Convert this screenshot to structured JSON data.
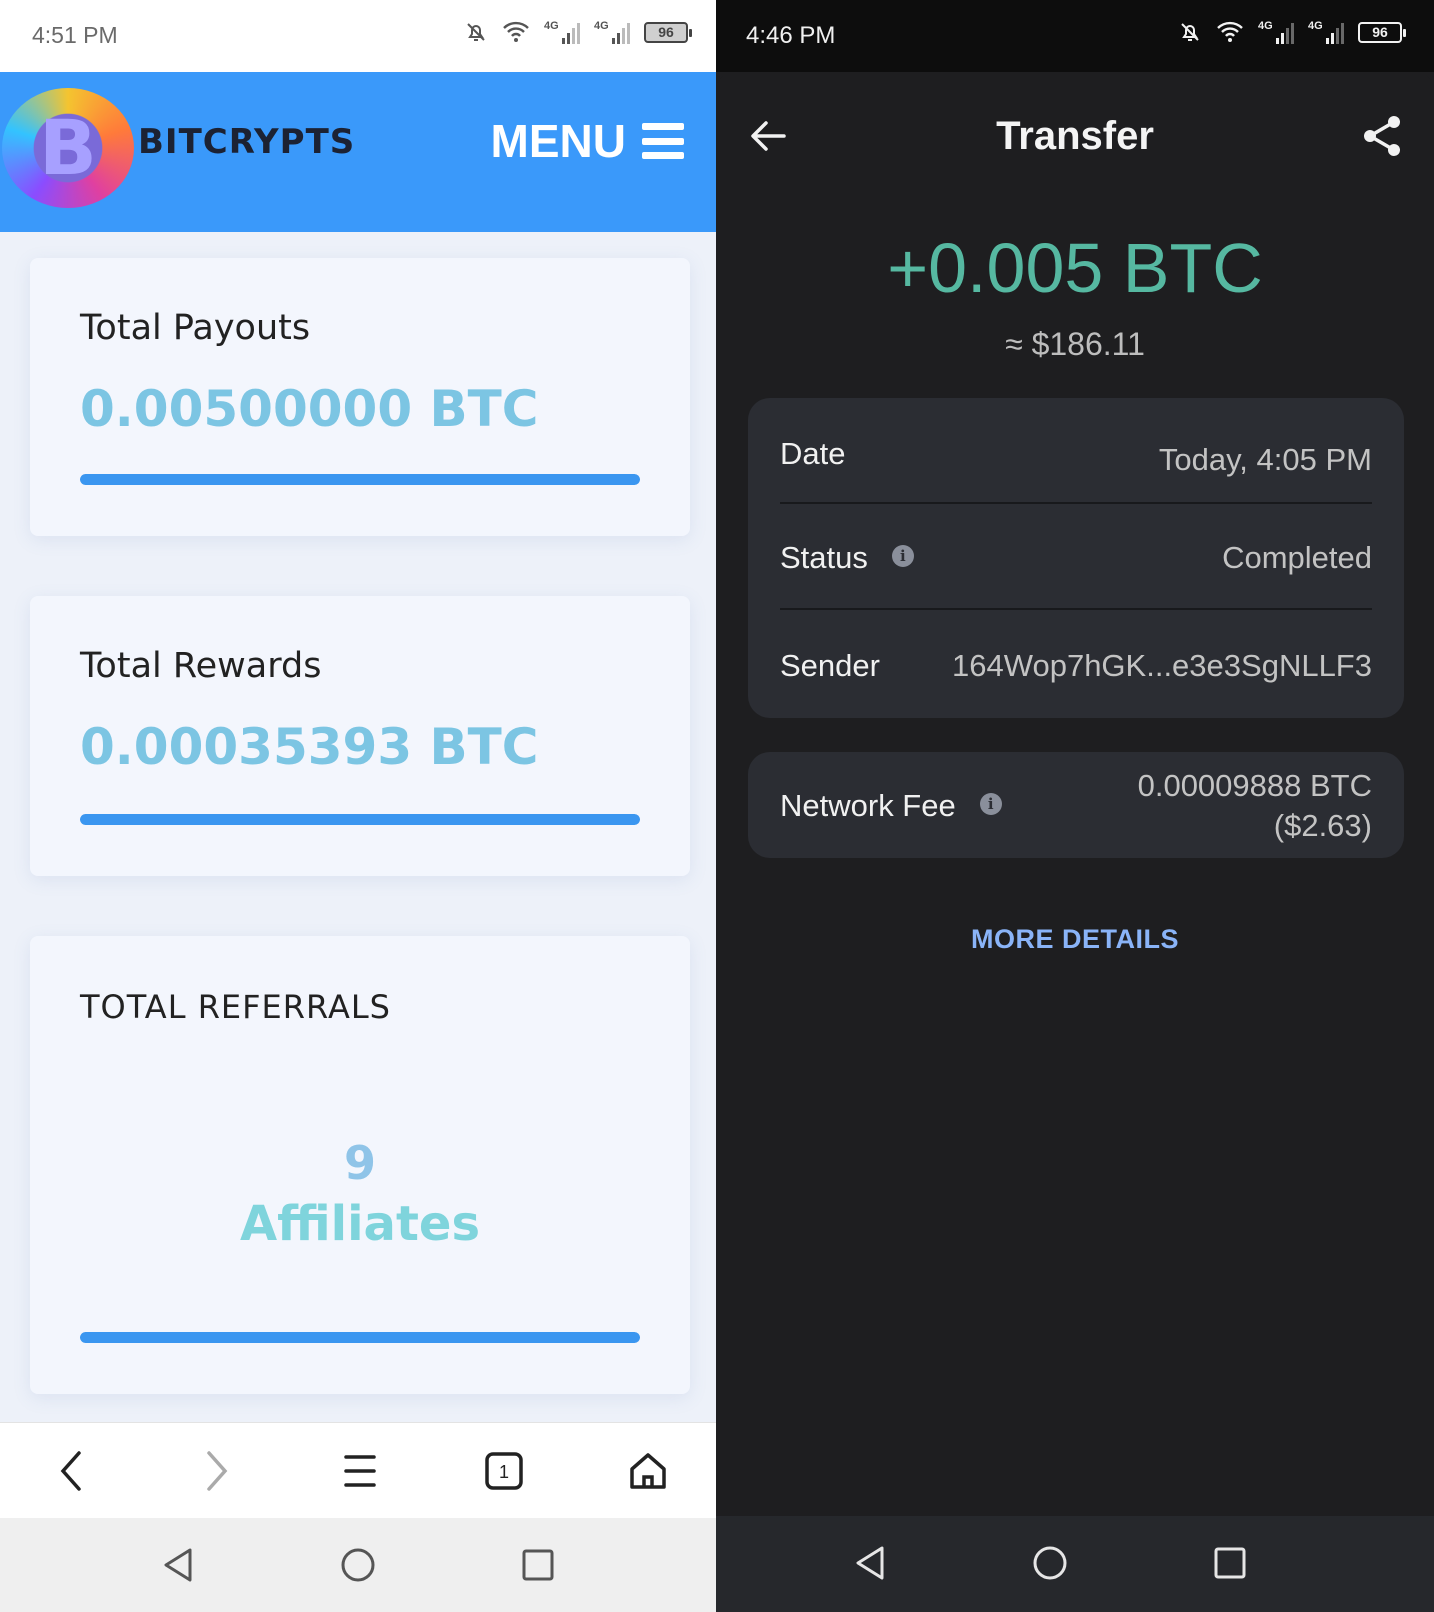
{
  "left": {
    "status_bar": {
      "time": "4:51 PM",
      "net1": "4G",
      "net2": "4G",
      "battery": "96"
    },
    "header": {
      "brand": "BITCRYPTS",
      "menu_label": "MENU",
      "logo_letter": "B"
    },
    "cards": {
      "payouts": {
        "title": "Total Payouts",
        "value": "0.00500000 BTC",
        "progress_percent": 100
      },
      "rewards": {
        "title": "Total Rewards",
        "value": "0.00035393 BTC",
        "progress_percent": 100
      },
      "referrals": {
        "title": "TOTAL REFERRALS",
        "count": "9",
        "unit": "Affiliates",
        "progress_percent": 100
      }
    },
    "browser_bar": {
      "tab_count": "1",
      "icons": [
        "back-icon",
        "forward-icon",
        "menu-icon",
        "tabs-icon",
        "home-icon"
      ]
    },
    "system_nav": [
      "back-triangle-icon",
      "home-circle-icon",
      "recents-square-icon"
    ]
  },
  "right": {
    "status_bar": {
      "time": "4:46 PM",
      "net1": "4G",
      "net2": "4G",
      "battery": "96"
    },
    "top_bar": {
      "title": "Transfer"
    },
    "amount": "+0.005 BTC",
    "amount_usd": "≈ $186.11",
    "details": {
      "date_label": "Date",
      "date_value": "Today, 4:05 PM",
      "status_label": "Status",
      "status_value": "Completed",
      "sender_label": "Sender",
      "sender_value": "164Wop7hGK...e3e3SgNLLF3"
    },
    "fee": {
      "label": "Network Fee",
      "btc": "0.00009888 BTC",
      "usd": "($2.63)"
    },
    "more_details": "MORE DETAILS",
    "colors": {
      "amount": "#56b8a1",
      "link": "#8ab4f8",
      "panel": "#2b2d33"
    }
  }
}
